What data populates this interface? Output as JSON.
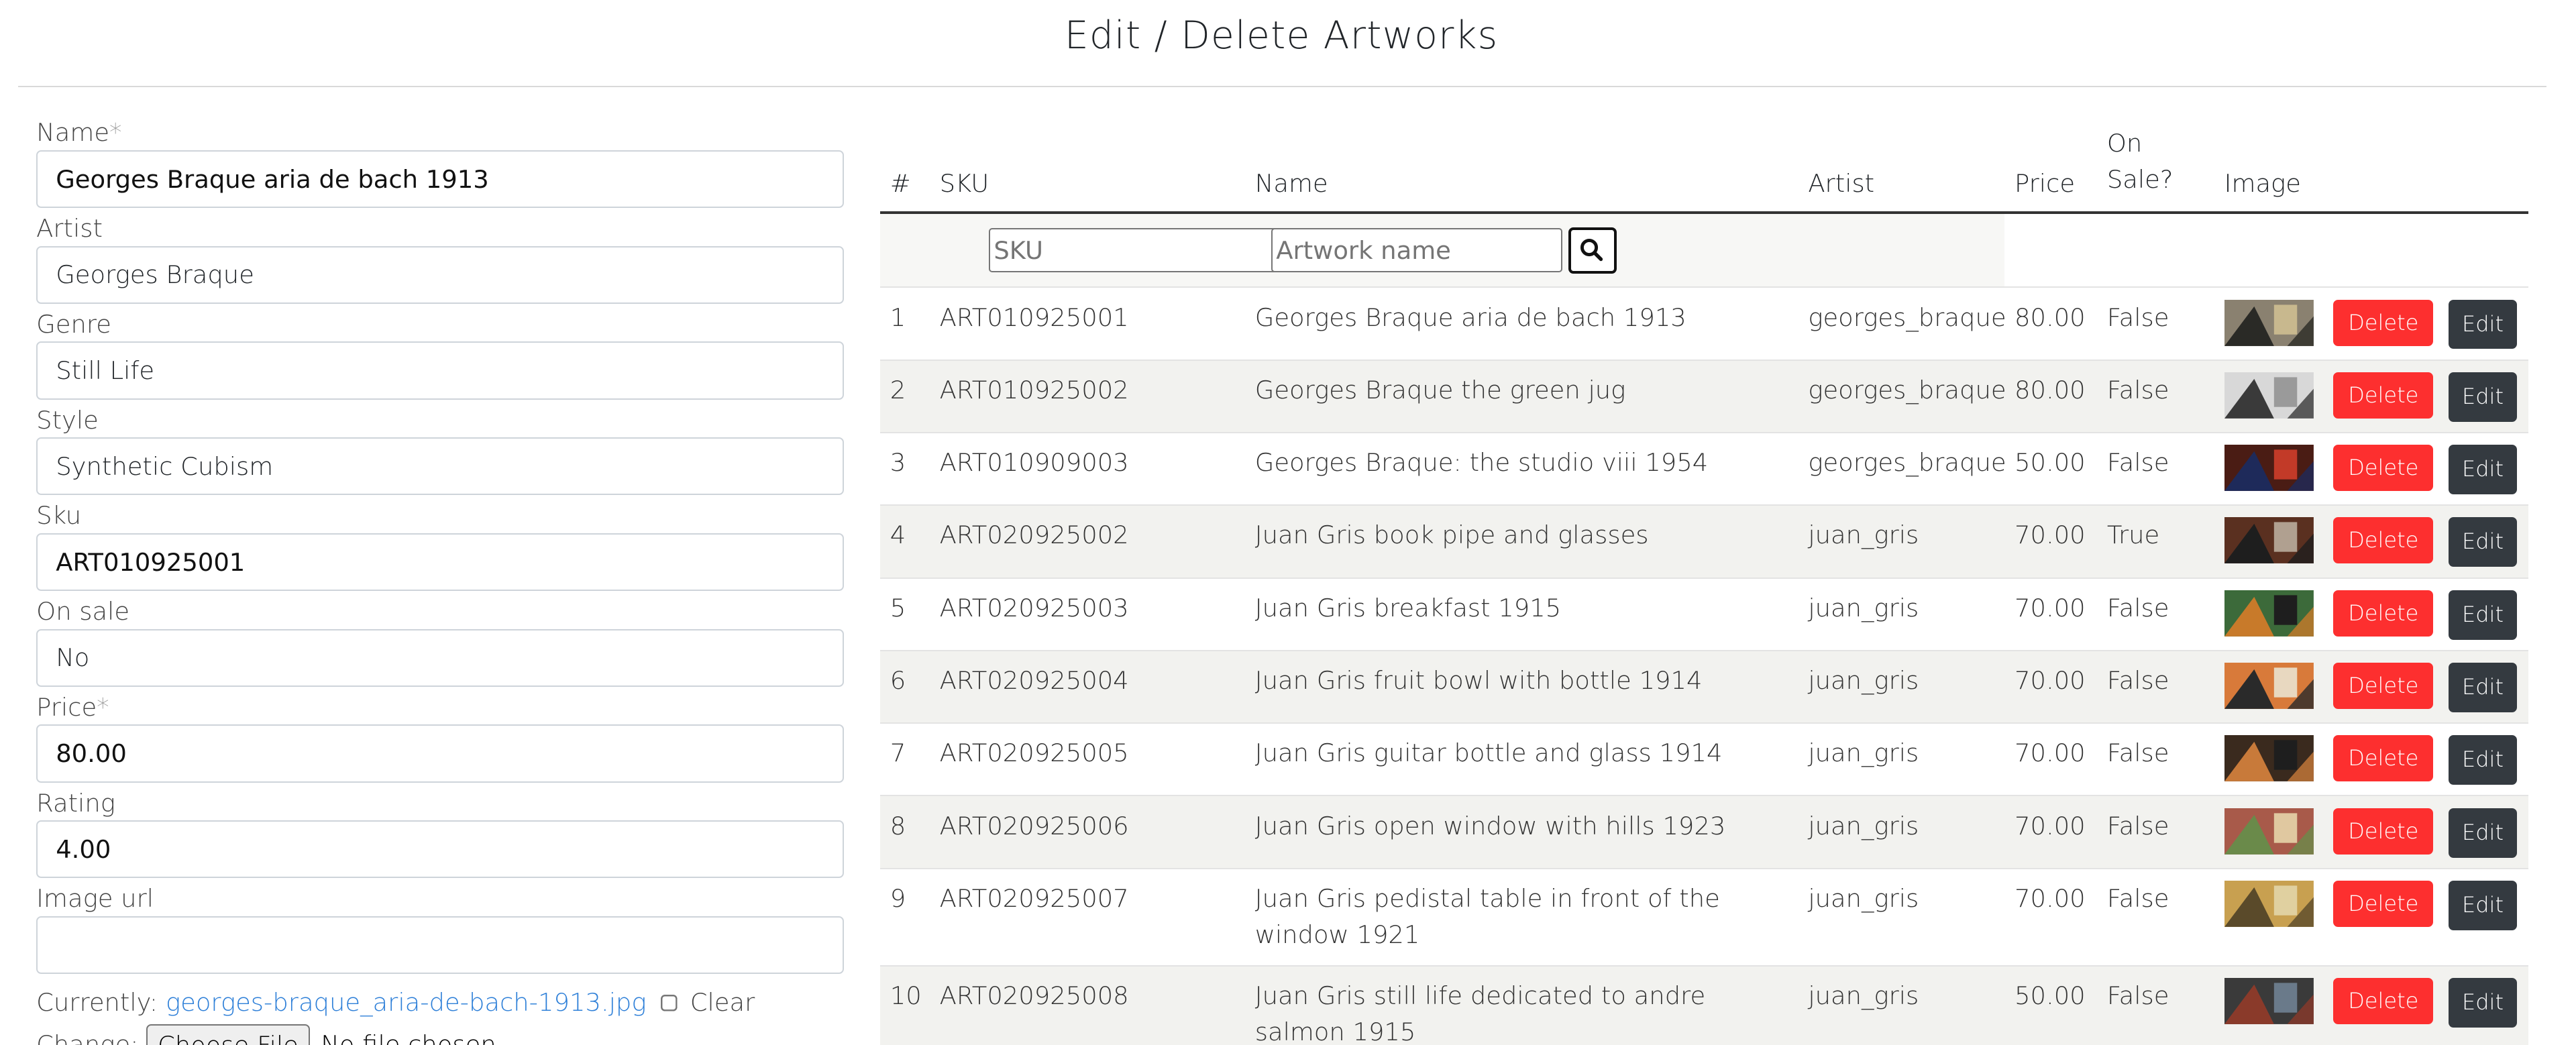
{
  "page": {
    "title": "Edit / Delete Artworks"
  },
  "form": {
    "fields": [
      {
        "label": "Name",
        "required": "*",
        "value": "Georges Braque aria de bach 1913",
        "strong": true
      },
      {
        "label": "Artist",
        "required": "",
        "value": "Georges Braque",
        "strong": false
      },
      {
        "label": "Genre",
        "required": "",
        "value": "Still Life",
        "strong": false
      },
      {
        "label": "Style",
        "required": "",
        "value": "Synthetic Cubism",
        "strong": false
      },
      {
        "label": "Sku",
        "required": "",
        "value": "ART010925001",
        "strong": true
      },
      {
        "label": "On sale",
        "required": "",
        "value": "No",
        "strong": false
      },
      {
        "label": "Price",
        "required": "*",
        "value": "80.00",
        "strong": true
      },
      {
        "label": "Rating",
        "required": "",
        "value": "4.00",
        "strong": true
      },
      {
        "label": "Image url",
        "required": "",
        "value": "",
        "strong": false
      }
    ],
    "currently_label": "Currently:",
    "current_file": "georges-braque_aria-de-bach-1913.jpg",
    "clear_label": "Clear",
    "change_label": "Change:",
    "choose_file_label": "Choose File",
    "no_file_label": "No file chosen"
  },
  "table": {
    "headers": {
      "num": "#",
      "sku": "SKU",
      "name": "Name",
      "artist": "Artist",
      "price": "Price",
      "onsale_line1": "On",
      "onsale_line2": "Sale?",
      "image": "Image"
    },
    "filter": {
      "sku_placeholder": "SKU",
      "name_placeholder": "Artwork name"
    },
    "delete_label": "Delete",
    "edit_label": "Edit",
    "rows": [
      {
        "num": "1",
        "sku": "ART010925001",
        "name": "Georges Braque aria de bach 1913",
        "artist": "georges_braque",
        "price": "80.00",
        "onsale": "False",
        "thumb": [
          "#8a8170",
          "#2a2a26",
          "#c8b88e"
        ]
      },
      {
        "num": "2",
        "sku": "ART010925002",
        "name": "Georges Braque the green jug",
        "artist": "georges_braque",
        "price": "80.00",
        "onsale": "False",
        "thumb": [
          "#d8d8d8",
          "#3a3a3a",
          "#9a9a9a"
        ]
      },
      {
        "num": "3",
        "sku": "ART010909003",
        "name": "Georges Braque: the studio viii 1954",
        "artist": "georges_braque",
        "price": "50.00",
        "onsale": "False",
        "thumb": [
          "#4a1c14",
          "#1e2a5a",
          "#c23a28"
        ]
      },
      {
        "num": "4",
        "sku": "ART020925002",
        "name": "Juan Gris book pipe and glasses",
        "artist": "juan_gris",
        "price": "70.00",
        "onsale": "True",
        "thumb": [
          "#5a3020",
          "#1e1e1e",
          "#b0a090"
        ]
      },
      {
        "num": "5",
        "sku": "ART020925003",
        "name": "Juan Gris breakfast 1915",
        "artist": "juan_gris",
        "price": "70.00",
        "onsale": "False",
        "thumb": [
          "#3c6a3a",
          "#c87a2a",
          "#1e1e1e"
        ]
      },
      {
        "num": "6",
        "sku": "ART020925004",
        "name": "Juan Gris fruit bowl with bottle 1914",
        "artist": "juan_gris",
        "price": "70.00",
        "onsale": "False",
        "thumb": [
          "#d87a3a",
          "#2a2a2a",
          "#e8d8c0"
        ]
      },
      {
        "num": "7",
        "sku": "ART020925005",
        "name": "Juan Gris guitar bottle and glass 1914",
        "artist": "juan_gris",
        "price": "70.00",
        "onsale": "False",
        "thumb": [
          "#3a2a1e",
          "#c87a3a",
          "#1e1e1e"
        ]
      },
      {
        "num": "8",
        "sku": "ART020925006",
        "name": "Juan Gris open window with hills 1923",
        "artist": "juan_gris",
        "price": "70.00",
        "onsale": "False",
        "thumb": [
          "#a85a4a",
          "#6a8a4a",
          "#e0c8a0"
        ]
      },
      {
        "num": "9",
        "sku": "ART020925007",
        "name": "Juan Gris pedistal table in front of the window 1921",
        "artist": "juan_gris",
        "price": "70.00",
        "onsale": "False",
        "thumb": [
          "#c8a050",
          "#5a4a2a",
          "#e0d0a0"
        ]
      },
      {
        "num": "10",
        "sku": "ART020925008",
        "name": "Juan Gris still life dedicated to andre salmon 1915",
        "artist": "juan_gris",
        "price": "50.00",
        "onsale": "False",
        "thumb": [
          "#3a3a3a",
          "#8a3a2a",
          "#6a7a8a"
        ]
      }
    ]
  }
}
